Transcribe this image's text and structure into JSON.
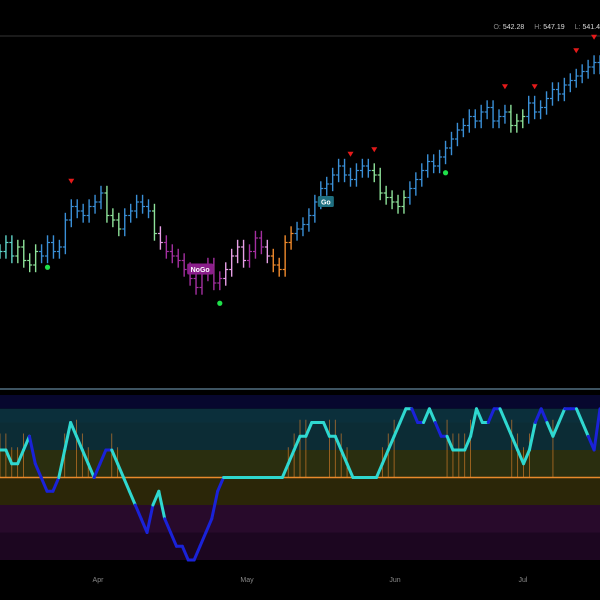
{
  "ohlc_readout": {
    "open_label": "O:",
    "open": "542.28",
    "high_label": "H:",
    "high": "547.19",
    "low_label": "L:",
    "low": "541.4"
  },
  "colors": {
    "background": "#000000",
    "strong_up": "#3a8fd6",
    "weak_up": "#5fd3c8",
    "neutral": "#8ee29a",
    "weak_down": "#e7a0e6",
    "strong_down": "#a32fa0",
    "go_fuel": "#f08a2c",
    "signal_down": "#e51a1a",
    "signal_up": "#1fe04a",
    "osc_strong": "#1a22d8",
    "osc_weak": "#2fd8d0",
    "zero_line": "#e8892b",
    "divider": "#7aa6c2"
  },
  "chart_data": [
    {
      "type": "ohlc",
      "x_axis": {
        "ticks": [
          "Apr",
          "May",
          "Jun",
          "Jul"
        ]
      },
      "y_range": [
        478,
        548
      ],
      "candles_close": [
        501,
        503,
        500,
        502,
        499,
        498,
        501,
        500,
        503,
        501,
        502,
        508,
        511,
        510,
        509,
        511,
        512,
        514,
        509,
        508,
        506,
        509,
        510,
        512,
        511,
        510,
        505,
        503,
        501,
        500,
        499,
        497,
        495,
        493,
        496,
        498,
        494,
        495,
        497,
        500,
        502,
        499,
        501,
        504,
        502,
        500,
        498,
        497,
        503,
        505,
        506,
        507,
        509,
        512,
        515,
        516,
        518,
        520,
        518,
        517,
        519,
        520,
        519,
        518,
        514,
        513,
        512,
        511,
        513,
        515,
        517,
        519,
        521,
        520,
        522,
        524,
        526,
        528,
        529,
        531,
        530,
        532,
        533,
        530,
        531,
        532,
        529,
        530,
        531,
        534,
        532,
        533,
        535,
        537,
        536,
        538,
        539,
        540,
        541,
        542,
        543,
        542
      ],
      "candles_state": [
        "wu",
        "wu",
        "wu",
        "n",
        "n",
        "n",
        "n",
        "su",
        "su",
        "su",
        "su",
        "su",
        "su",
        "su",
        "su",
        "su",
        "su",
        "su",
        "n",
        "n",
        "n",
        "su",
        "su",
        "su",
        "su",
        "su",
        "n",
        "wd",
        "sd",
        "sd",
        "sd",
        "sd",
        "sd",
        "sd",
        "sd",
        "sd",
        "sd",
        "sd",
        "wd",
        "wd",
        "wd",
        "wd",
        "sd",
        "sd",
        "sd",
        "wd",
        "g",
        "g",
        "g",
        "g",
        "su",
        "su",
        "su",
        "su",
        "su",
        "su",
        "su",
        "su",
        "su",
        "su",
        "su",
        "su",
        "su",
        "n",
        "n",
        "n",
        "n",
        "n",
        "n",
        "su",
        "su",
        "su",
        "su",
        "su",
        "su",
        "su",
        "su",
        "su",
        "su",
        "su",
        "su",
        "su",
        "su",
        "su",
        "su",
        "su",
        "n",
        "n",
        "n",
        "su",
        "su",
        "su",
        "su",
        "su",
        "su",
        "su",
        "su",
        "su",
        "su",
        "su",
        "su",
        "su"
      ],
      "signals": [
        {
          "type": "down",
          "at": 12
        },
        {
          "type": "down",
          "at": 59
        },
        {
          "type": "down",
          "at": 63
        },
        {
          "type": "down",
          "at": 85
        },
        {
          "type": "down",
          "at": 90
        },
        {
          "type": "down",
          "at": 97
        },
        {
          "type": "down",
          "at": 100
        },
        {
          "type": "up",
          "at": 8
        },
        {
          "type": "up",
          "at": 37
        },
        {
          "type": "up",
          "at": 75
        }
      ],
      "labels": [
        {
          "text": "NoGo",
          "at": 31
        },
        {
          "text": "Go",
          "at": 53
        }
      ]
    },
    {
      "type": "line",
      "name_hidden": true,
      "y_range": [
        -6,
        6
      ],
      "bands": [
        6,
        5,
        4,
        2,
        0,
        -2,
        -4,
        -6
      ],
      "values": [
        2,
        2,
        1,
        1,
        2,
        3,
        1,
        0,
        -1,
        -1,
        0,
        2,
        4,
        3,
        2,
        1,
        0,
        1,
        2,
        2,
        1,
        0,
        -1,
        -2,
        -3,
        -4,
        -2,
        -1,
        -3,
        -4,
        -5,
        -5,
        -6,
        -6,
        -5,
        -4,
        -3,
        -1,
        0,
        0,
        0,
        0,
        0,
        0,
        0,
        0,
        0,
        0,
        0,
        1,
        2,
        3,
        3,
        4,
        4,
        4,
        3,
        3,
        2,
        1,
        0,
        0,
        0,
        0,
        0,
        1,
        2,
        3,
        4,
        5,
        5,
        4,
        4,
        5,
        4,
        3,
        3,
        2,
        2,
        2,
        3,
        5,
        4,
        4,
        5,
        5,
        4,
        3,
        2,
        1,
        2,
        4,
        5,
        4,
        3,
        4,
        5,
        5,
        5,
        4,
        3,
        2,
        5
      ],
      "states": [
        "w",
        "w",
        "w",
        "w",
        "w",
        "s",
        "s",
        "s",
        "s",
        "s",
        "w",
        "w",
        "w",
        "w",
        "w",
        "w",
        "s",
        "s",
        "s",
        "w",
        "w",
        "w",
        "w",
        "s",
        "s",
        "s",
        "w",
        "w",
        "s",
        "s",
        "s",
        "s",
        "s",
        "s",
        "s",
        "s",
        "s",
        "s",
        "w",
        "w",
        "w",
        "w",
        "w",
        "w",
        "w",
        "w",
        "w",
        "w",
        "w",
        "w",
        "w",
        "w",
        "w",
        "w",
        "w",
        "w",
        "w",
        "w",
        "w",
        "w",
        "w",
        "w",
        "w",
        "w",
        "w",
        "w",
        "w",
        "w",
        "w",
        "w",
        "s",
        "s",
        "w",
        "w",
        "s",
        "s",
        "w",
        "w",
        "w",
        "w",
        "w",
        "w",
        "w",
        "s",
        "s",
        "w",
        "w",
        "w",
        "w",
        "w",
        "w",
        "s",
        "s",
        "w",
        "w",
        "w",
        "s",
        "s",
        "w",
        "w",
        "s",
        "s"
      ]
    }
  ]
}
